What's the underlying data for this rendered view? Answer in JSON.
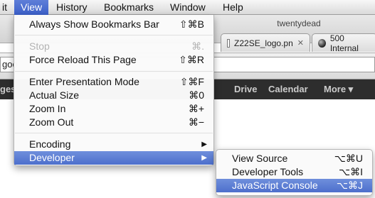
{
  "menubar": {
    "items": [
      {
        "label": "it"
      },
      {
        "label": "View"
      },
      {
        "label": "History"
      },
      {
        "label": "Bookmarks"
      },
      {
        "label": "Window"
      },
      {
        "label": "Help"
      }
    ]
  },
  "window": {
    "title": "twentydead",
    "tabs": [
      {
        "label": "Z22SE_logo.pn",
        "close": "✕",
        "icon": "document-icon"
      },
      {
        "label": "500 Internal",
        "icon": "globe-icon"
      }
    ],
    "address_text": "goo",
    "google_bar": {
      "items": [
        "ges",
        "Drive",
        "Calendar",
        "More ▾"
      ]
    }
  },
  "view_menu": {
    "items": [
      {
        "label": "Always Show Bookmarks Bar",
        "shortcut": "⇧⌘B"
      },
      {
        "label": "Stop",
        "shortcut": "⌘.",
        "disabled": true
      },
      {
        "label": "Force Reload This Page",
        "shortcut": "⇧⌘R"
      },
      {
        "label": "Enter Presentation Mode",
        "shortcut": "⇧⌘F"
      },
      {
        "label": "Actual Size",
        "shortcut": "⌘0"
      },
      {
        "label": "Zoom In",
        "shortcut": "⌘+"
      },
      {
        "label": "Zoom Out",
        "shortcut": "⌘−"
      },
      {
        "label": "Encoding",
        "submenu_arrow": "▶"
      },
      {
        "label": "Developer",
        "submenu_arrow": "▶",
        "highlighted": true
      }
    ]
  },
  "developer_submenu": {
    "items": [
      {
        "label": "View Source",
        "shortcut": "⌥⌘U"
      },
      {
        "label": "Developer Tools",
        "shortcut": "⌥⌘I"
      },
      {
        "label": "JavaScript Console",
        "shortcut": "⌥⌘J",
        "highlighted": true
      }
    ]
  },
  "colors": {
    "highlight": "#4d6fcc",
    "google_bar": "#2d2d2d"
  }
}
